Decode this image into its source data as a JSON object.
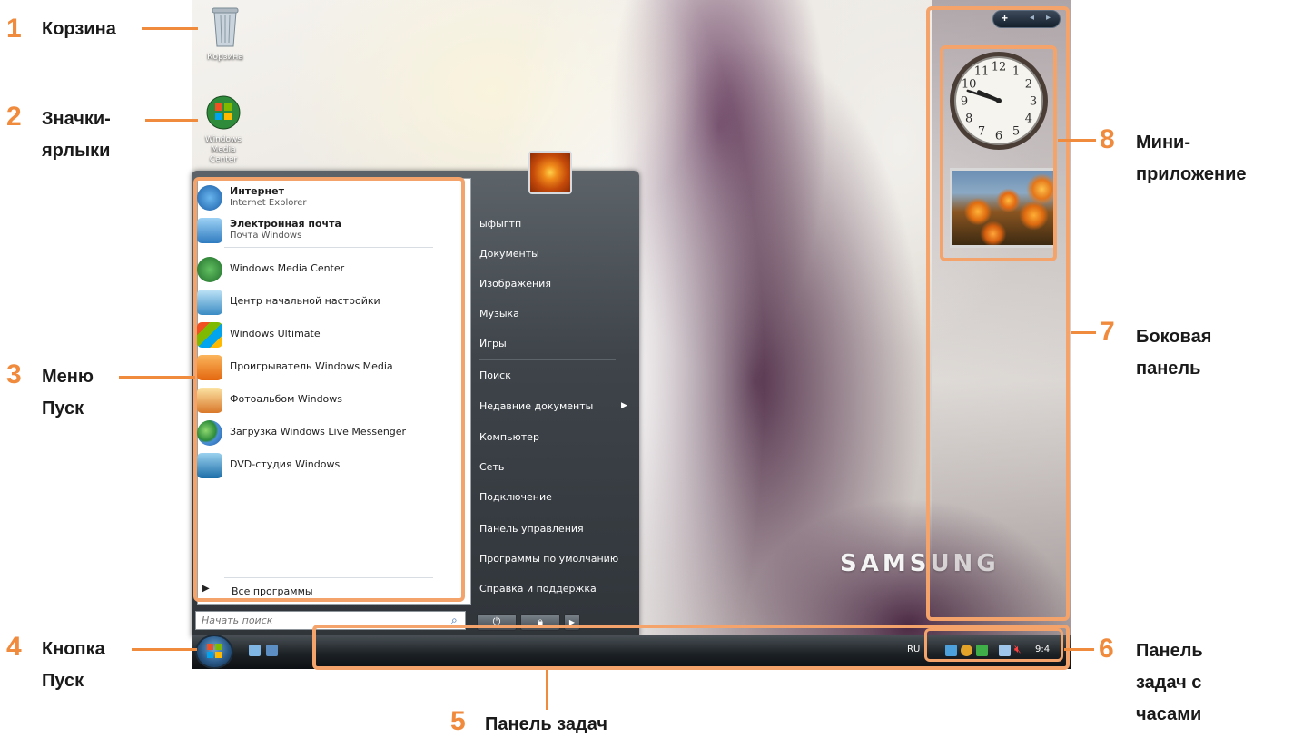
{
  "desktop": {
    "icons": [
      {
        "label": "Корзина",
        "icon": "recycle-bin-icon"
      },
      {
        "label": "Windows Media Center",
        "icon": "windows-media-center-icon"
      }
    ],
    "watermark": "SAMSUNG"
  },
  "start_menu": {
    "user_picture": "flower-user-picture",
    "pinned": [
      {
        "title": "Интернет",
        "subtitle": "Internet Explorer",
        "icon": "internet-explorer-icon"
      },
      {
        "title": "Электронная почта",
        "subtitle": "Почта Windows",
        "icon": "windows-mail-icon"
      }
    ],
    "recent": [
      {
        "label": "Windows Media Center",
        "icon": "windows-media-center-icon"
      },
      {
        "label": "Центр начальной настройки",
        "icon": "welcome-center-icon"
      },
      {
        "label": "Windows Ultimate",
        "icon": "windows-ultimate-icon"
      },
      {
        "label": "Проигрыватель Windows Media",
        "icon": "windows-media-player-icon"
      },
      {
        "label": "Фотоальбом Windows",
        "icon": "photo-gallery-icon"
      },
      {
        "label": "Загрузка Windows Live Messenger",
        "icon": "live-messenger-icon"
      },
      {
        "label": "DVD-студия Windows",
        "icon": "dvd-maker-icon"
      }
    ],
    "all_programs": "Все программы",
    "search_placeholder": "Начать поиск",
    "right_items": [
      "ыфыгтп",
      "Документы",
      "Изображения",
      "Музыка",
      "Игры",
      "Поиск",
      "Недавние документы",
      "Компьютер",
      "Сеть",
      "Подключение",
      "Панель управления",
      "Программы по умолчанию",
      "Справка и поддержка"
    ]
  },
  "taskbar": {
    "language": "RU",
    "clock": "9:4",
    "quick_launch": [
      "show-desktop-icon",
      "switch-windows-icon"
    ],
    "tray_icons": [
      "network-icon",
      "security-icon",
      "update-icon",
      "display-icon",
      "volume-muted-icon"
    ]
  },
  "sidebar": {
    "controls": {
      "add": "+",
      "prev": "◂",
      "next": "▸"
    },
    "gadgets": [
      {
        "type": "clock",
        "numbers": [
          "12",
          "1",
          "2",
          "3",
          "4",
          "5",
          "6",
          "7",
          "8",
          "9",
          "10",
          "11"
        ],
        "time_shown": "9:48"
      },
      {
        "type": "slideshow",
        "icon": "slideshow-photo"
      }
    ]
  },
  "annotations": [
    {
      "num": "1",
      "text": "Корзина"
    },
    {
      "num": "2",
      "text": "Значки-",
      "text2": "ярлыки"
    },
    {
      "num": "3",
      "text": "Меню",
      "text2": "Пуск"
    },
    {
      "num": "4",
      "text": "Кнопка",
      "text2": "Пуск"
    },
    {
      "num": "5",
      "text": "Панель задач"
    },
    {
      "num": "6",
      "text": "Панель",
      "text2": "задач с",
      "text3": "часами"
    },
    {
      "num": "7",
      "text": "Боковая",
      "text2": "панель"
    },
    {
      "num": "8",
      "text": "Мини-",
      "text2": "приложение"
    }
  ],
  "colors": {
    "accent": "#f08a3c",
    "box": "#f4a36a"
  }
}
